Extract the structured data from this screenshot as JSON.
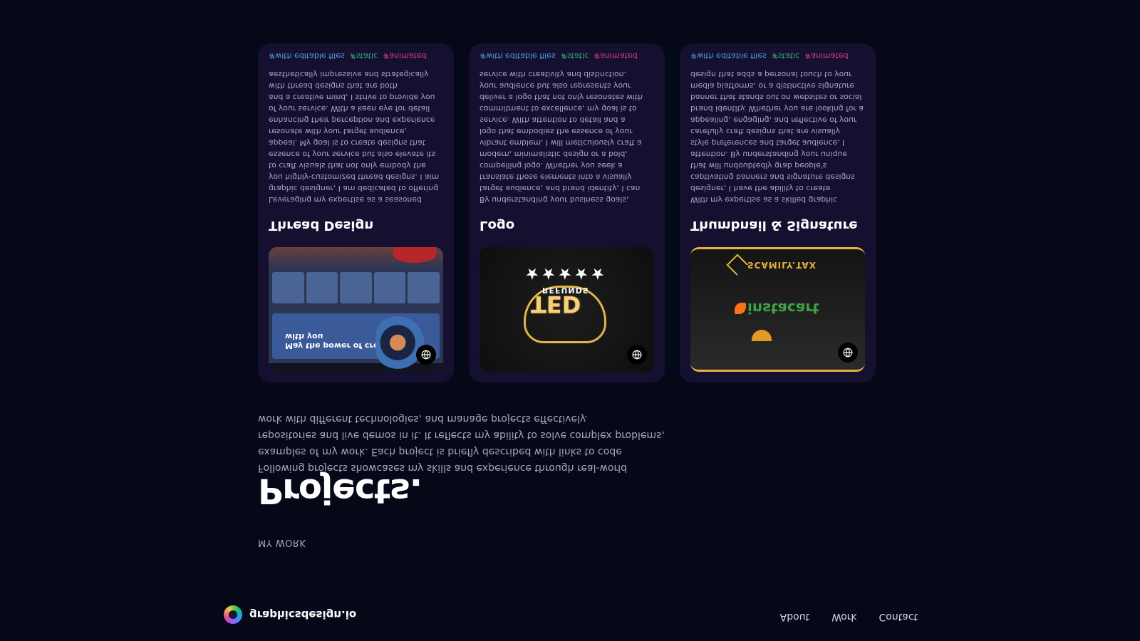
{
  "nav": {
    "logo_text": "graphicsdesign.io",
    "links": [
      "About",
      "Work",
      "Contact"
    ]
  },
  "section": {
    "sub": "MY WORK",
    "title": "Projects.",
    "intro": "Following projects showcases my skills and experience through real-world examples of my work. Each project is briefly described with links to code repositories and live demos in it. It reflects my ability to solve complex problems, work with different technologies, and manage projects effectively."
  },
  "projects": [
    {
      "title": "Thread Design",
      "description": "Leveraging my expertise as a seasoned graphic designer, I am dedicated to offering you highly-customized thread designs. I aim to craft visuals that not only embody the essence of your service but also elevate its appeal. My goal is to create designs that resonate with your target audience, enhancing their perception and experience of your service. With a keen eye for detail and a creative mind, I strive to provide you with thread designs that are both aesthetically impressive and strategically effective.",
      "tags": [
        "#with editable files",
        "#static",
        "#animated"
      ],
      "thumb_text": "May the power of creativity be with you",
      "thumb_alt": "Thread design preview"
    },
    {
      "title": "Logo",
      "description": "By understanding your business goals, target audience, and brand identity, I can translate those elements into a visually compelling logo. Whether you seek a modern, minimalistic design or a bold, vibrant emblem, I will meticulously craft a logo that embodies the essence of your service. With attention to detail and a commitment to excellence, my goal is to deliver a logo that not only resonates with your audience but also represents your service with creativity and distinction.",
      "tags": [
        "#with editable files",
        "#static",
        "#animated"
      ],
      "thumb_text": "TED",
      "thumb_sub": "REFUNDS"
    },
    {
      "title": "Thumbnail & Signature",
      "description": "With my expertise as a skilled graphic designer, I have the ability to create captivating banners and signature designs that will undoubtedly grab people's attention. By understanding your unique style preferences and target audience, I carefully craft designs that are visually appealing, engaging, and reflective of your brand identity. Whether you are looking for a banner that stands out on websites or social media platforms, or a distinctive signature design that adds a personal touch to your service.",
      "tags": [
        "#with editable files",
        "#static",
        "#animated"
      ],
      "thumb_text": "instacart",
      "thumb_sub": "SCAMILY.TAX"
    }
  ],
  "colors": {
    "background": "#050816",
    "card": "#151030",
    "secondary_text": "#aaa6c3",
    "tag_blue": "#4d9fe0",
    "tag_green": "#2fb57a",
    "tag_pink": "#e0407a"
  },
  "icons": {
    "live_link": "globe-icon"
  }
}
